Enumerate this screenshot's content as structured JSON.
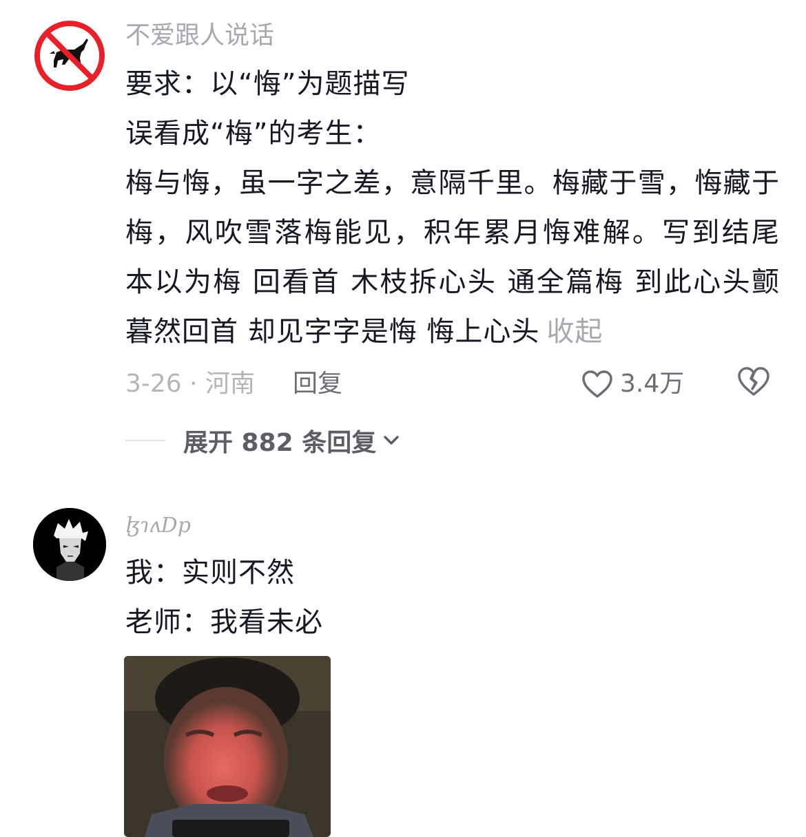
{
  "comments": [
    {
      "username": "不爱跟人说话",
      "avatar_icon": "no-dog-sign-icon",
      "lines": [
        "要求：以“悔”为题描写",
        "误看成“梅”的考生：",
        "梅与悔，虽一字之差，意隔千里。梅藏于雪，悔藏于梅，风吹雪落梅能见，积年累月悔难解。写到结尾 本以为梅 回看首 木枝拆心头 通全篇梅 到此心头颤 暮然回首 却见字字是悔 悔上心头"
      ],
      "collapse_label": "收起",
      "date_location": "3-26 · 河南",
      "reply_label": "回复",
      "like_count": "3.4万",
      "expand_replies_label": "展开 882 条回复"
    },
    {
      "username": "ɮɿʌDp",
      "avatar_icon": "anime-avatar-icon",
      "lines": [
        "我：实则不然",
        "老师：我看未必"
      ],
      "media_icon": "crying-boy-meme-image"
    }
  ],
  "colors": {
    "text_primary": "#161823",
    "text_secondary": "#a8a8ae",
    "no_sign_red": "#e8202a"
  }
}
